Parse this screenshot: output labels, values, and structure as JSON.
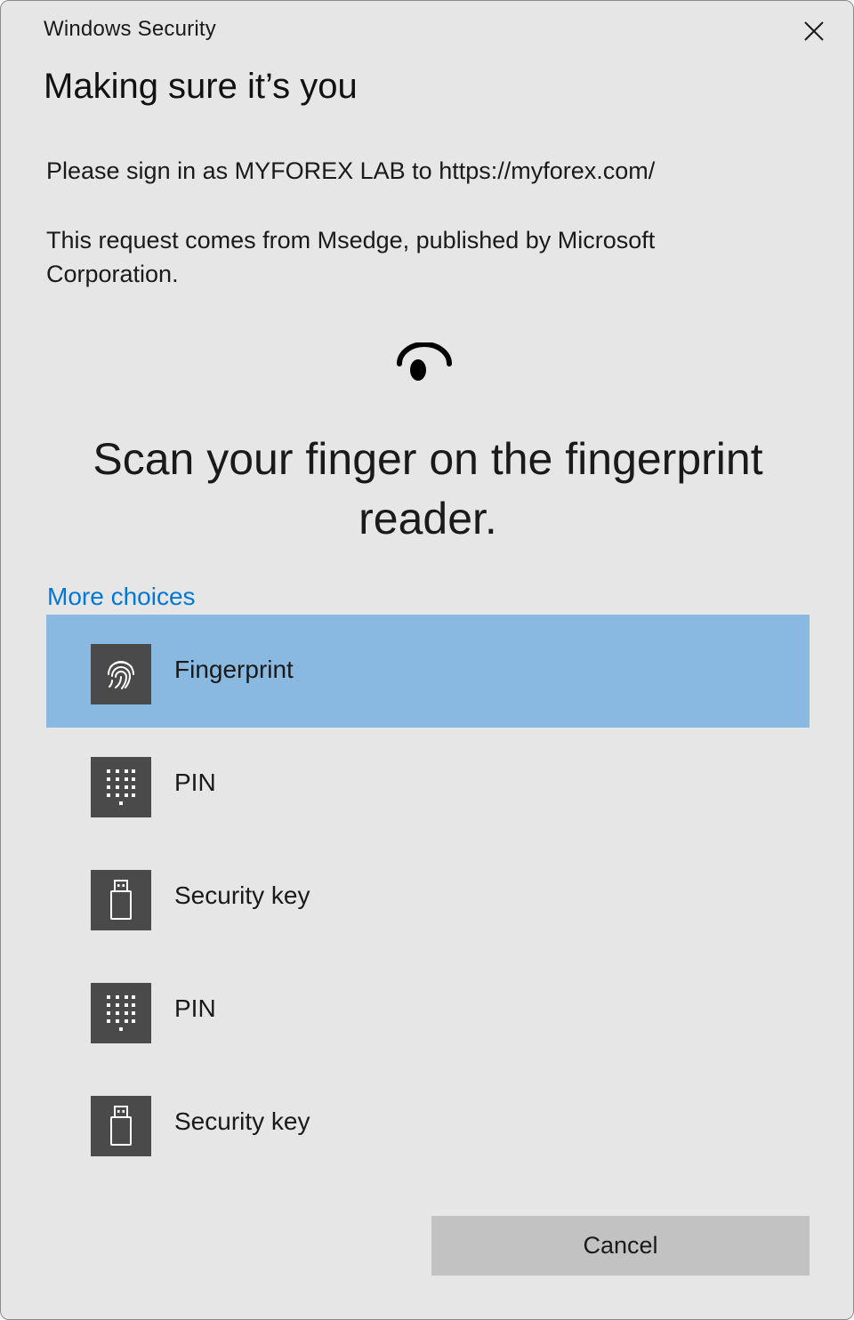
{
  "window": {
    "title": "Windows Security",
    "close_icon": "close-icon"
  },
  "heading": "Making sure it’s you",
  "sign_in_text": "Please sign in as MYFOREX LAB to https://myforex.com/",
  "request_text": "This request comes from Msedge, published by Microsoft Corporation.",
  "sensor_icon": "fingerprint-sensor-icon",
  "instruction": "Scan your finger on the fingerprint reader.",
  "more_choices": "More choices",
  "options": [
    {
      "label": "Fingerprint",
      "icon": "fingerprint-icon",
      "selected": true
    },
    {
      "label": "PIN",
      "icon": "keypad-icon",
      "selected": false
    },
    {
      "label": "Security key",
      "icon": "usb-key-icon",
      "selected": false
    },
    {
      "label": "PIN",
      "icon": "keypad-icon",
      "selected": false
    },
    {
      "label": "Security key",
      "icon": "usb-key-icon",
      "selected": false
    }
  ],
  "cancel_label": "Cancel",
  "colors": {
    "dialog_background": "#e6e6e6",
    "selected_option": "#89b8e0",
    "link": "#0078d7",
    "icon_tile": "#4a4a4a",
    "cancel_button": "#c2c2c2"
  }
}
